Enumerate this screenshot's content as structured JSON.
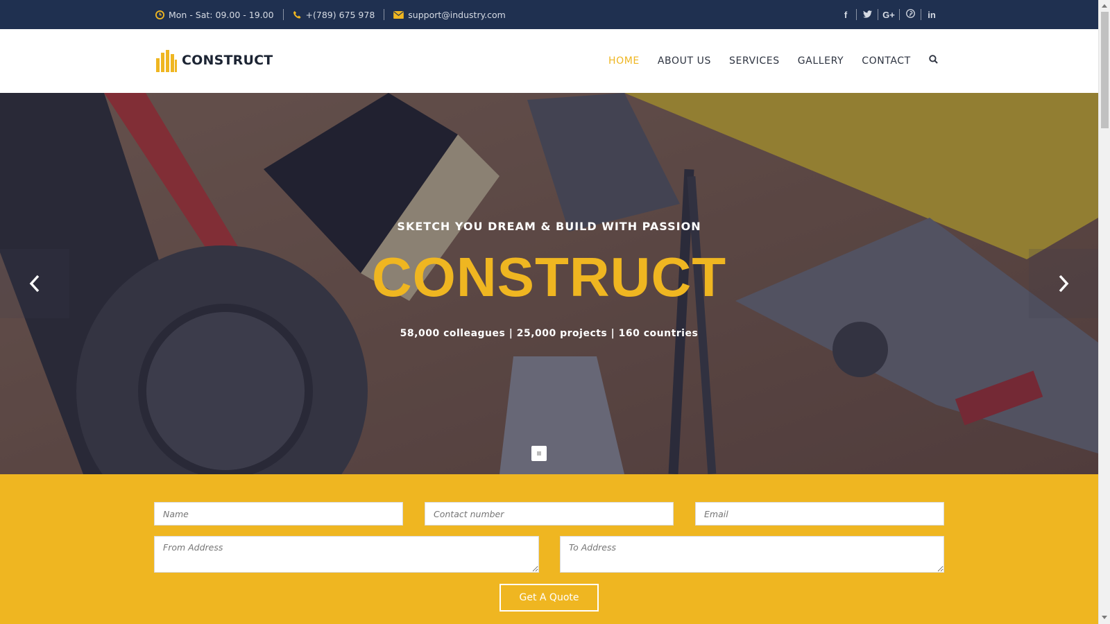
{
  "topbar": {
    "hours": "Mon - Sat: 09.00 - 19.00",
    "phone": "+(789) 675 978",
    "email": "support@industry.com",
    "social": [
      "f",
      "t",
      "G+",
      "p",
      "in"
    ]
  },
  "brand": {
    "name": "CONSTRUCT"
  },
  "nav": {
    "items": [
      "HOME",
      "ABOUT US",
      "SERVICES",
      "GALLERY",
      "CONTACT"
    ],
    "active": "HOME"
  },
  "hero": {
    "tagline": "SKETCH YOU DREAM & BUILD WITH PASSION",
    "title": "CONSTRUCT",
    "stats": "58,000 colleagues | 25,000 projects | 160 countries"
  },
  "form": {
    "name_placeholder": "Name",
    "contact_placeholder": "Contact number",
    "email_placeholder": "Email",
    "from_placeholder": "From Address",
    "to_placeholder": "To Address",
    "submit_label": "Get A Quote"
  },
  "colors": {
    "navy": "#1f3050",
    "accent": "#efb621",
    "text": "#2d3340"
  },
  "icons": [
    "clock-icon",
    "phone-icon",
    "envelope-icon",
    "facebook-icon",
    "twitter-icon",
    "google-plus-icon",
    "pinterest-icon",
    "linkedin-icon",
    "search-icon",
    "chevron-left-icon",
    "chevron-right-icon"
  ]
}
